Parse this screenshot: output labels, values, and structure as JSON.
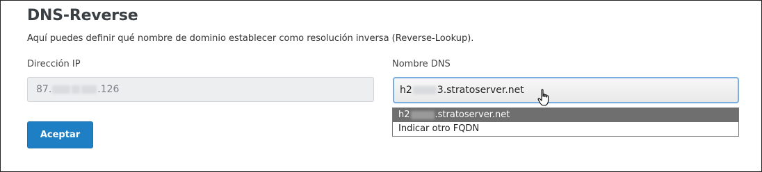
{
  "section": {
    "title": "DNS-Reverse",
    "description": "Aquí puedes definir qué nombre de dominio establecer como resolución inversa (Reverse-Lookup)."
  },
  "ip": {
    "label": "Dirección IP",
    "value_prefix": "87.",
    "value_suffix": ".126"
  },
  "dns": {
    "label": "Nombre DNS",
    "selected_prefix": "h2",
    "selected_suffix": "3.stratoserver.net",
    "options": [
      {
        "prefix": "h2",
        "suffix": ".stratoserver.net"
      },
      {
        "text": "Indicar otro FQDN"
      }
    ]
  },
  "actions": {
    "accept_label": "Aceptar"
  },
  "colors": {
    "accent": "#1f7fc4",
    "focus_border": "#7aaee0",
    "selected_option": "#6f6f6f"
  }
}
